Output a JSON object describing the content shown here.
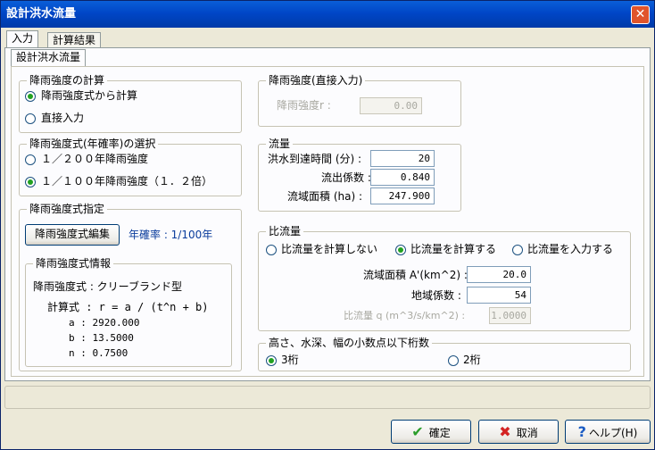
{
  "window": {
    "title": "設計洪水流量",
    "close": "✕"
  },
  "tabs": {
    "input": "入力",
    "results": "計算結果",
    "sub": "設計洪水流量"
  },
  "rain_calc": {
    "title": "降雨強度の計算",
    "opt_formula": "降雨強度式から計算",
    "opt_direct": "直接入力"
  },
  "formula_select": {
    "title": "降雨強度式(年確率)の選択",
    "opt_200": "１／２００年降雨強度",
    "opt_100": "１／１００年降雨強度（１．２倍）"
  },
  "formula_spec": {
    "title": "降雨強度式指定",
    "edit_button": "降雨強度式編集",
    "probability": "年確率 : 1/100年",
    "info_title": "降雨強度式情報",
    "formula_name": "降雨強度式 : クリーブランド型",
    "calc_formula": "計算式 : r = a / (t^n + b)",
    "a": "a : 2920.000",
    "b": "b : 13.5000",
    "n": "n : 0.7500"
  },
  "direct_input": {
    "title": "降雨強度(直接入力)",
    "label": "降雨強度r :",
    "value": "0.00"
  },
  "flow": {
    "title": "流量",
    "arrival_label": "洪水到達時間 (分) :",
    "arrival_value": "20",
    "runoff_label": "流出係数 :",
    "runoff_value": "0.840",
    "area_label": "流域面積 (ha) :",
    "area_value": "247.900"
  },
  "specific": {
    "title": "比流量",
    "opt_none": "比流量を計算しない",
    "opt_calc": "比流量を計算する",
    "opt_input": "比流量を入力する",
    "area_label": "流域面積 A'(km^2) :",
    "area_value": "20.0",
    "coef_label": "地域係数 :",
    "coef_value": "54",
    "q_label": "比流量 q (m^3/s/km^2) :",
    "q_value": "1.0000"
  },
  "decimals": {
    "title": "高さ、水深、幅の小数点以下桁数",
    "opt3": "3桁",
    "opt2": "2桁"
  },
  "footer": {
    "ok": "確定",
    "cancel": "取消",
    "help": "ヘルプ(H)"
  }
}
